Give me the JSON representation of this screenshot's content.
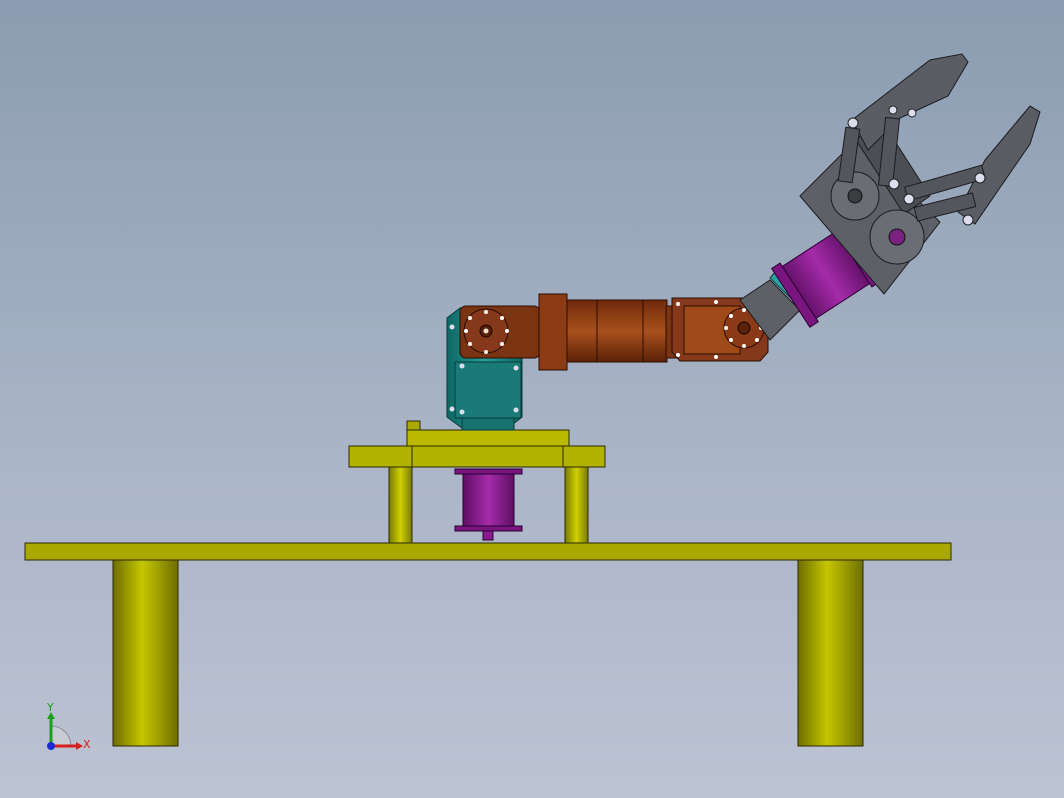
{
  "viewport": {
    "background_top": "#8b9cb1",
    "background_bottom": "#bcc3d3"
  },
  "colors": {
    "table": "#b7b800",
    "table_dark": "#6e6e00",
    "servo_base": "#8a1a8e",
    "shoulder": "#1f8a87",
    "arm": "#8b3c14",
    "arm_mid": "#a04a1a",
    "gripper": "#5a5d63",
    "wrist_servo": "#8a1a8e"
  },
  "triad": {
    "x_label": "X",
    "y_label": "Y",
    "x_color": "#d62020",
    "y_color": "#1aa01a",
    "z_color": "#1a2ad6"
  }
}
